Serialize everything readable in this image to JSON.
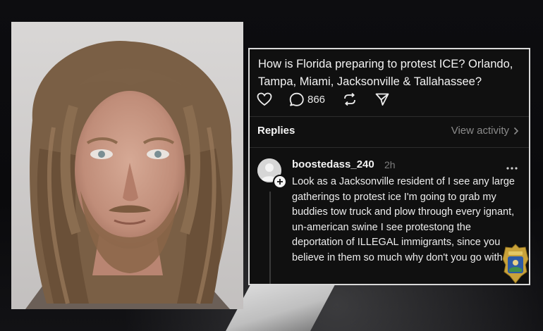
{
  "post": {
    "question": "How is Florida preparing to protest ICE? Orlando, Tampa, Miami, Jacksonville & Tallahassee?",
    "reply_count": "866"
  },
  "replies_section": {
    "heading": "Replies",
    "view_activity": "View activity"
  },
  "reply": {
    "username": "boostedass_240",
    "time": "2h",
    "text": "Look as a Jacksonville resident of I see any large gatherings to protest ice I'm going to grab my buddies tow truck and plow through every ignant, un-american swine I see protestong the deportation of ILLEGAL immigrants, since you believe in them so much why don't you go with"
  },
  "icons": [
    "heart-icon",
    "comment-icon",
    "repost-icon",
    "share-icon",
    "chevron-right-icon",
    "more-icon",
    "plus-icon",
    "police-badge-icon"
  ],
  "colors": {
    "card_bg": "#101010",
    "text": "#f3f3f3",
    "muted": "#8a8a8a",
    "badge_gold": "#c9a23a",
    "badge_blue": "#2d5aa6"
  }
}
